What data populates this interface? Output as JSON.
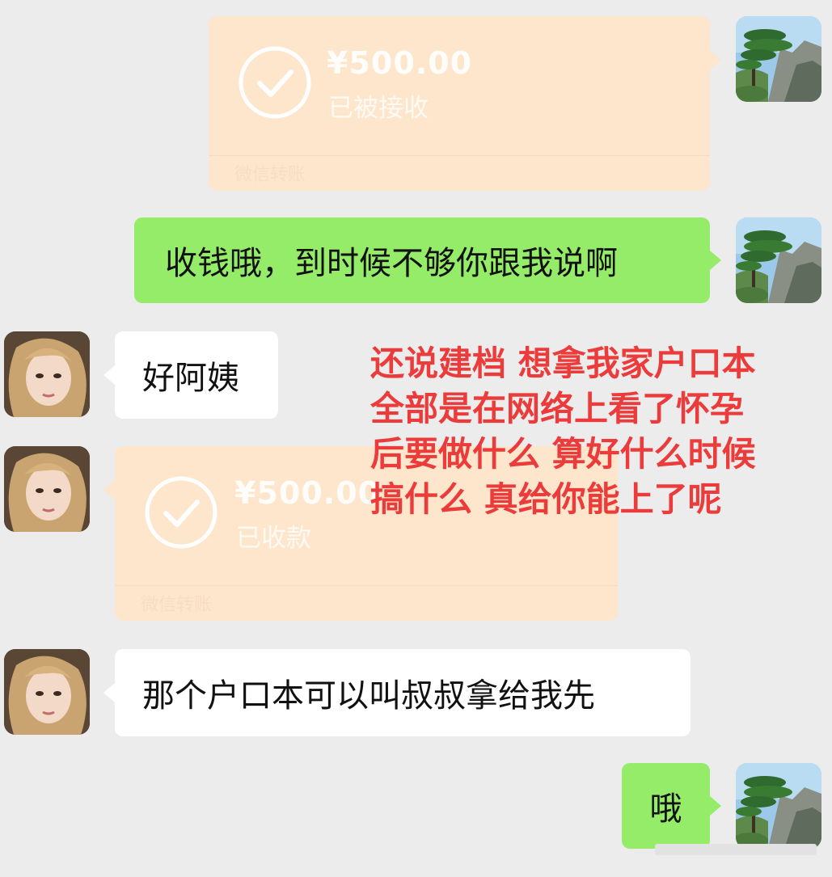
{
  "messages": {
    "transfer_sent": {
      "amount": "¥500.00",
      "status": "已被接收",
      "footer": "微信转账"
    },
    "text_sent_1": "收钱哦，到时候不够你跟我说啊",
    "text_received_1": "好阿姨",
    "transfer_received": {
      "amount": "¥500.00",
      "status": "已收款",
      "footer": "微信转账"
    },
    "text_received_2": "那个户口本可以叫叔叔拿给我先",
    "text_sent_2": "哦"
  },
  "overlay_caption": {
    "lines": [
      "还说建档 想拿我家户口本",
      "全部是在网络上看了怀孕",
      "后要做什么 算好什么时候",
      "搞什么 真给你能上了呢"
    ]
  },
  "colors": {
    "background": "#ececec",
    "sent_bubble": "#95ec69",
    "received_bubble": "#ffffff",
    "transfer_card": "#fde6cc",
    "caption": "#ec3b3b"
  },
  "icons": {
    "transfer_status": "check-circle-icon",
    "self_avatar": "landscape-pine-avatar",
    "other_avatar": "girl-portrait-avatar"
  }
}
